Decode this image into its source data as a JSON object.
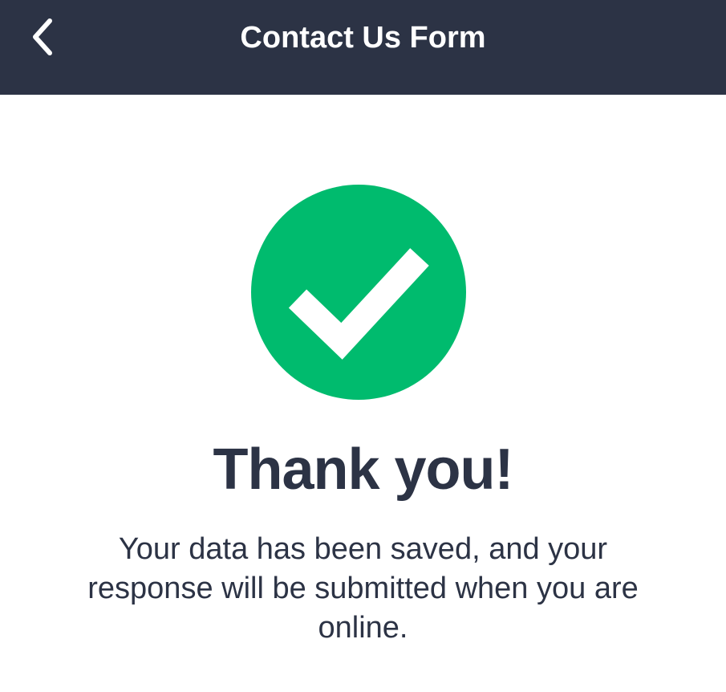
{
  "header": {
    "title": "Contact Us Form",
    "back_icon": "chevron-left-icon",
    "background_color": "#2c3345"
  },
  "success": {
    "icon": "checkmark-circle-icon",
    "icon_color": "#00bb6e",
    "heading": "Thank you!",
    "message": "Your data has been saved, and your response will be submitted when you are online."
  }
}
